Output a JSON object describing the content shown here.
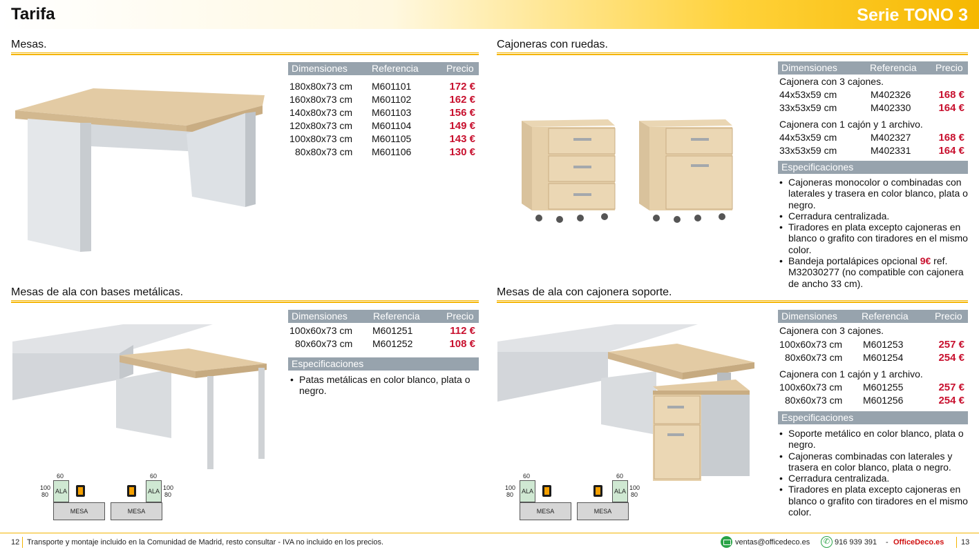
{
  "header": {
    "title": "Tarifa",
    "series": "Serie TONO 3"
  },
  "columns": {
    "dimensions": "Dimensiones",
    "reference": "Referencia",
    "price": "Precio"
  },
  "specs_label": "Especificaciones",
  "mesas": {
    "title": "Mesas.",
    "rows": [
      {
        "dim": "180x80x73 cm",
        "ref": "M601101",
        "price": "172 €"
      },
      {
        "dim": "160x80x73 cm",
        "ref": "M601102",
        "price": "162 €"
      },
      {
        "dim": "140x80x73 cm",
        "ref": "M601103",
        "price": "156 €"
      },
      {
        "dim": "120x80x73 cm",
        "ref": "M601104",
        "price": "149 €"
      },
      {
        "dim": "100x80x73 cm",
        "ref": "M601105",
        "price": "143 €"
      },
      {
        "dim": "80x80x73 cm",
        "ref": "M601106",
        "price": "130 €"
      }
    ]
  },
  "cajoneras": {
    "title": "Cajoneras con ruedas.",
    "group1_label": "Cajonera con 3 cajones.",
    "group1": [
      {
        "dim": "44x53x59 cm",
        "ref": "M402326",
        "price": "168 €"
      },
      {
        "dim": "33x53x59 cm",
        "ref": "M402330",
        "price": "164 €"
      }
    ],
    "group2_label": "Cajonera con 1 cajón y 1 archivo.",
    "group2": [
      {
        "dim": "44x53x59 cm",
        "ref": "M402327",
        "price": "168 €"
      },
      {
        "dim": "33x53x59 cm",
        "ref": "M402331",
        "price": "164 €"
      }
    ],
    "specs": [
      "Cajoneras monocolor o combinadas con laterales y trasera en color blanco, plata o negro.",
      "Cerradura centralizada.",
      "Tiradores en plata excepto cajoneras en blanco o grafito con tiradores en el mismo color."
    ],
    "spec_tray_before": "Bandeja portalápices opcional ",
    "spec_tray_price": "9€",
    "spec_tray_after": " ref. M32030277 (no compatible con cajonera de ancho 33 cm)."
  },
  "ala_metal": {
    "title": "Mesas de ala con bases metálicas.",
    "rows": [
      {
        "dim": "100x60x73 cm",
        "ref": "M601251",
        "price": "112 €"
      },
      {
        "dim": "80x60x73 cm",
        "ref": "M601252",
        "price": "108 €"
      }
    ],
    "specs": [
      "Patas metálicas en color blanco, plata o negro."
    ]
  },
  "ala_cajonera": {
    "title": "Mesas de ala con cajonera soporte.",
    "group1_label": "Cajonera con 3 cajones.",
    "group1": [
      {
        "dim": "100x60x73 cm",
        "ref": "M601253",
        "price": "257 €"
      },
      {
        "dim": "80x60x73 cm",
        "ref": "M601254",
        "price": "254 €"
      }
    ],
    "group2_label": "Cajonera con 1 cajón y 1 archivo.",
    "group2": [
      {
        "dim": "100x60x73 cm",
        "ref": "M601255",
        "price": "257 €"
      },
      {
        "dim": "80x60x73 cm",
        "ref": "M601256",
        "price": "254 €"
      }
    ],
    "specs": [
      "Soporte metálico en color blanco, plata o negro.",
      "Cajoneras combinadas con laterales y trasera en color blanco, plata o negro.",
      "Cerradura centralizada.",
      "Tiradores en plata excepto cajoneras en blanco o grafito con tiradores en el mismo color."
    ]
  },
  "diagram": {
    "mesa": "MESA",
    "ala": "ALA",
    "w": "60",
    "d1": "100",
    "d2": "80"
  },
  "footer": {
    "page_left": "12",
    "note": "Transporte y montaje incluido en la Comunidad de Madrid, resto consultar - IVA no incluido en los precios.",
    "email": "ventas@officedeco.es",
    "phone": "916 939 391",
    "dash": "-",
    "brand": "OfficeDeco.es",
    "page_right": "13"
  }
}
